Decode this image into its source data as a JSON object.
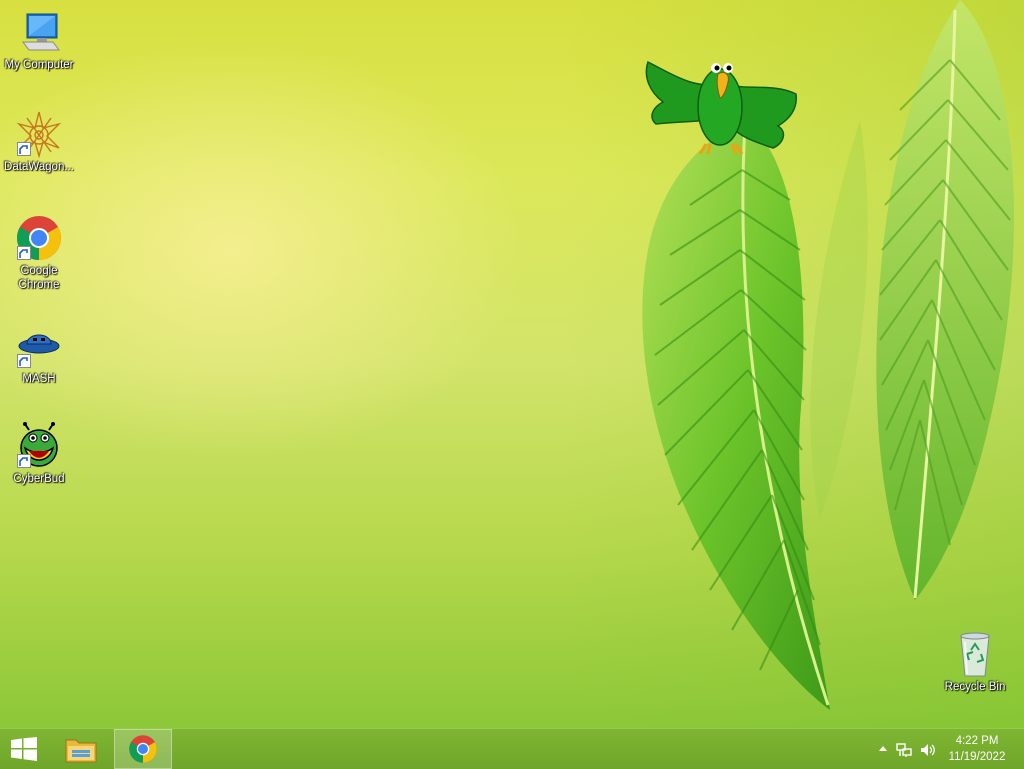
{
  "desktop": {
    "icons": [
      {
        "label": "My Computer"
      },
      {
        "label": "DataWagon..."
      },
      {
        "label": "Google Chrome"
      },
      {
        "label": "MASH"
      },
      {
        "label": "CyberBud"
      },
      {
        "label": "Recycle Bin"
      }
    ]
  },
  "taskbar": {
    "start_icon": "windows-logo-icon",
    "pinned": [
      {
        "name": "File Explorer",
        "icon": "folder-icon"
      },
      {
        "name": "Google Chrome",
        "icon": "chrome-icon",
        "active": true
      }
    ],
    "tray": {
      "icons": [
        "chevron-up-icon",
        "network-icon",
        "speaker-icon"
      ],
      "time": "4:22 PM",
      "date": "11/19/2022"
    }
  },
  "colors": {
    "taskbar": "#74ab2d",
    "wallpaper_top": "#d8e040",
    "wallpaper_bottom": "#8cc838"
  }
}
